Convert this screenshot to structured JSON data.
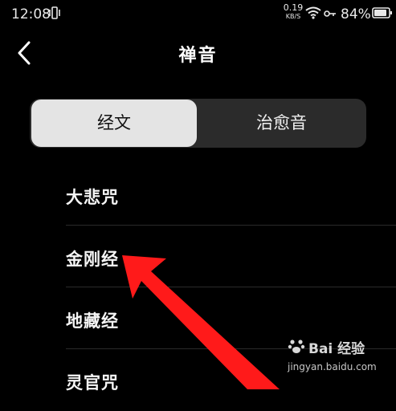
{
  "status_bar": {
    "time": "12:08",
    "net_speed_value": "0.19",
    "net_speed_unit": "KB/S",
    "battery": "84%"
  },
  "header": {
    "title": "禅音"
  },
  "tabs": [
    {
      "label": "经文",
      "selected": true
    },
    {
      "label": "治愈音",
      "selected": false
    }
  ],
  "list": [
    {
      "label": "大悲咒"
    },
    {
      "label": "金刚经"
    },
    {
      "label": "地藏经"
    },
    {
      "label": "灵官咒"
    }
  ],
  "watermark": {
    "brand": "Bai 经验",
    "url": "jingyan.baidu.com"
  },
  "colors": {
    "background": "#000000",
    "tab_selected_bg": "#e4e4e4",
    "tab_track_bg": "#2b2b2b",
    "annotation_arrow": "#ff1a1a"
  },
  "icons": {
    "back": "chevron-left-icon",
    "vibrate": "vibrate-icon",
    "wifi": "wifi-icon",
    "battery": "battery-icon",
    "vpn": "key-icon"
  }
}
